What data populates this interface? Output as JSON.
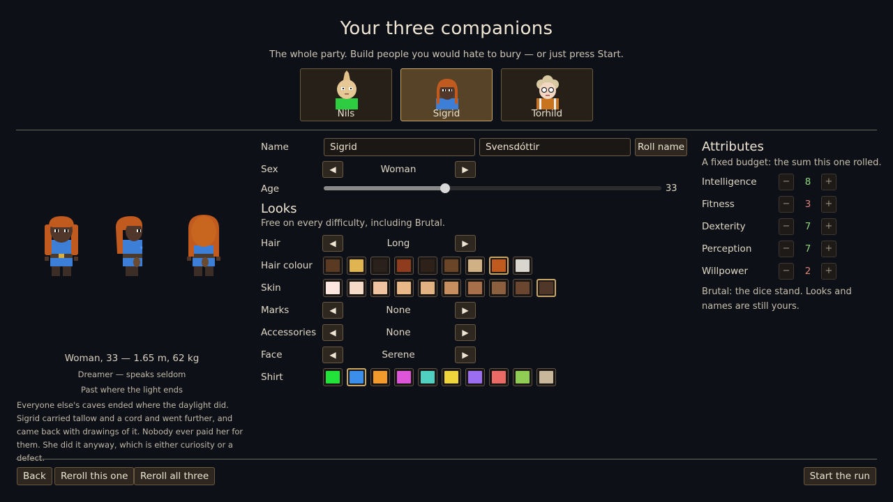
{
  "header": {
    "title": "Your three companions",
    "subtitle": "The whole party. Build people you would hate to bury — or just press Start."
  },
  "companions": [
    {
      "name": "Nils",
      "selected": false,
      "hair_color": "#e2c08a",
      "shirt_color": "#2ecc40"
    },
    {
      "name": "Sigrid",
      "selected": true,
      "hair_color": "#c05a1e",
      "shirt_color": "#3d7fd6"
    },
    {
      "name": "Torhild",
      "selected": false,
      "hair_color": "#d8c9a3",
      "shirt_color": "#c8731e"
    }
  ],
  "preview": {
    "summary": "Woman, 33 — 1.65 m, 62 kg",
    "trait": "Dreamer — speaks seldom",
    "background": "Past where the light ends",
    "bio": "Everyone else's caves ended where the daylight did. Sigrid carried tallow and a cord and went further, and came back with drawings of it. Nobody ever paid her for them. She did it anyway, which is either curiosity or a defect."
  },
  "form": {
    "name_label": "Name",
    "first_name": "Sigrid",
    "last_name": "Svensdóttir",
    "roll_name": "Roll name",
    "sex_label": "Sex",
    "sex_value": "Woman",
    "age_label": "Age",
    "age_value": "33",
    "age_fraction": 0.36,
    "prev_glyph": "◀",
    "next_glyph": "▶"
  },
  "looks": {
    "title": "Looks",
    "subtitle": "Free on every difficulty, including Brutal.",
    "hair_label": "Hair",
    "hair_value": "Long",
    "hair_colour_label": "Hair colour",
    "hair_colours": [
      "#5b3a24",
      "#e0b450",
      "#2a211c",
      "#8e3b1e",
      "#2e2119",
      "#6b4527",
      "#cfb185",
      "#c05a1e",
      "#d9d6cf"
    ],
    "hair_colour_selected": 7,
    "skin_label": "Skin",
    "skin_tones": [
      "#fbe7df",
      "#f6dac8",
      "#f0c4a0",
      "#eab888",
      "#e2b283",
      "#c78e60",
      "#a8704a",
      "#8c603f",
      "#6a4630",
      "#51362a"
    ],
    "skin_selected": 9,
    "marks_label": "Marks",
    "marks_value": "None",
    "accessories_label": "Accessories",
    "accessories_value": "None",
    "face_label": "Face",
    "face_value": "Serene",
    "shirt_label": "Shirt",
    "shirt_colours": [
      "#22e33a",
      "#3b8eea",
      "#f39a2c",
      "#dd55d8",
      "#4fd0c0",
      "#efd53b",
      "#9b6df0",
      "#ea6a66",
      "#8fcd55",
      "#c9b79b"
    ],
    "shirt_selected": 1
  },
  "attributes": {
    "title": "Attributes",
    "subtitle": "A fixed budget: the sum this one rolled.",
    "minus": "−",
    "plus": "+",
    "items": [
      {
        "name": "Intelligence",
        "value": "8",
        "color": "#8fd97e"
      },
      {
        "name": "Fitness",
        "value": "3",
        "color": "#e0837a"
      },
      {
        "name": "Dexterity",
        "value": "7",
        "color": "#8fd97e"
      },
      {
        "name": "Perception",
        "value": "7",
        "color": "#8fd97e"
      },
      {
        "name": "Willpower",
        "value": "2",
        "color": "#e0837a"
      }
    ],
    "note": "Brutal: the dice stand. Looks and names are still yours."
  },
  "footer": {
    "back": "Back",
    "reroll_one": "Reroll this one",
    "reroll_all": "Reroll all three",
    "start": "Start the run"
  },
  "colors": {
    "background": "#0d1016",
    "accent": "#c9a867",
    "selected_card": "#574428"
  }
}
